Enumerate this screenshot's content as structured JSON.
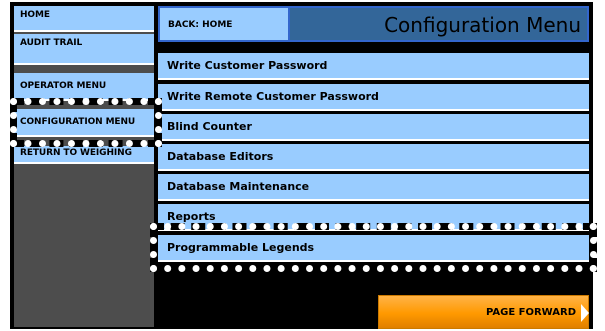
{
  "sidebar": {
    "items": [
      {
        "label": "HOME"
      },
      {
        "label": "AUDIT TRAIL"
      },
      {
        "label": "OPERATOR MENU"
      },
      {
        "label": "CONFIGURATION MENU"
      },
      {
        "label": "RETURN TO WEIGHING"
      }
    ]
  },
  "header": {
    "back_label": "BACK: HOME",
    "title": "Configuration Menu"
  },
  "menu": {
    "items": [
      {
        "label": "Write Customer Password"
      },
      {
        "label": "Write Remote Customer Password"
      },
      {
        "label": "Blind Counter"
      },
      {
        "label": "Database Editors"
      },
      {
        "label": "Database Maintenance"
      },
      {
        "label": "Reports"
      },
      {
        "label": "Programmable Legends"
      }
    ]
  },
  "footer": {
    "page_forward_label": "PAGE FORWARD"
  },
  "colors": {
    "item_bg": "#99ccff",
    "title_bg": "#336699",
    "sidebar_bg": "#4d4d4d",
    "accent": "#ff9900"
  }
}
